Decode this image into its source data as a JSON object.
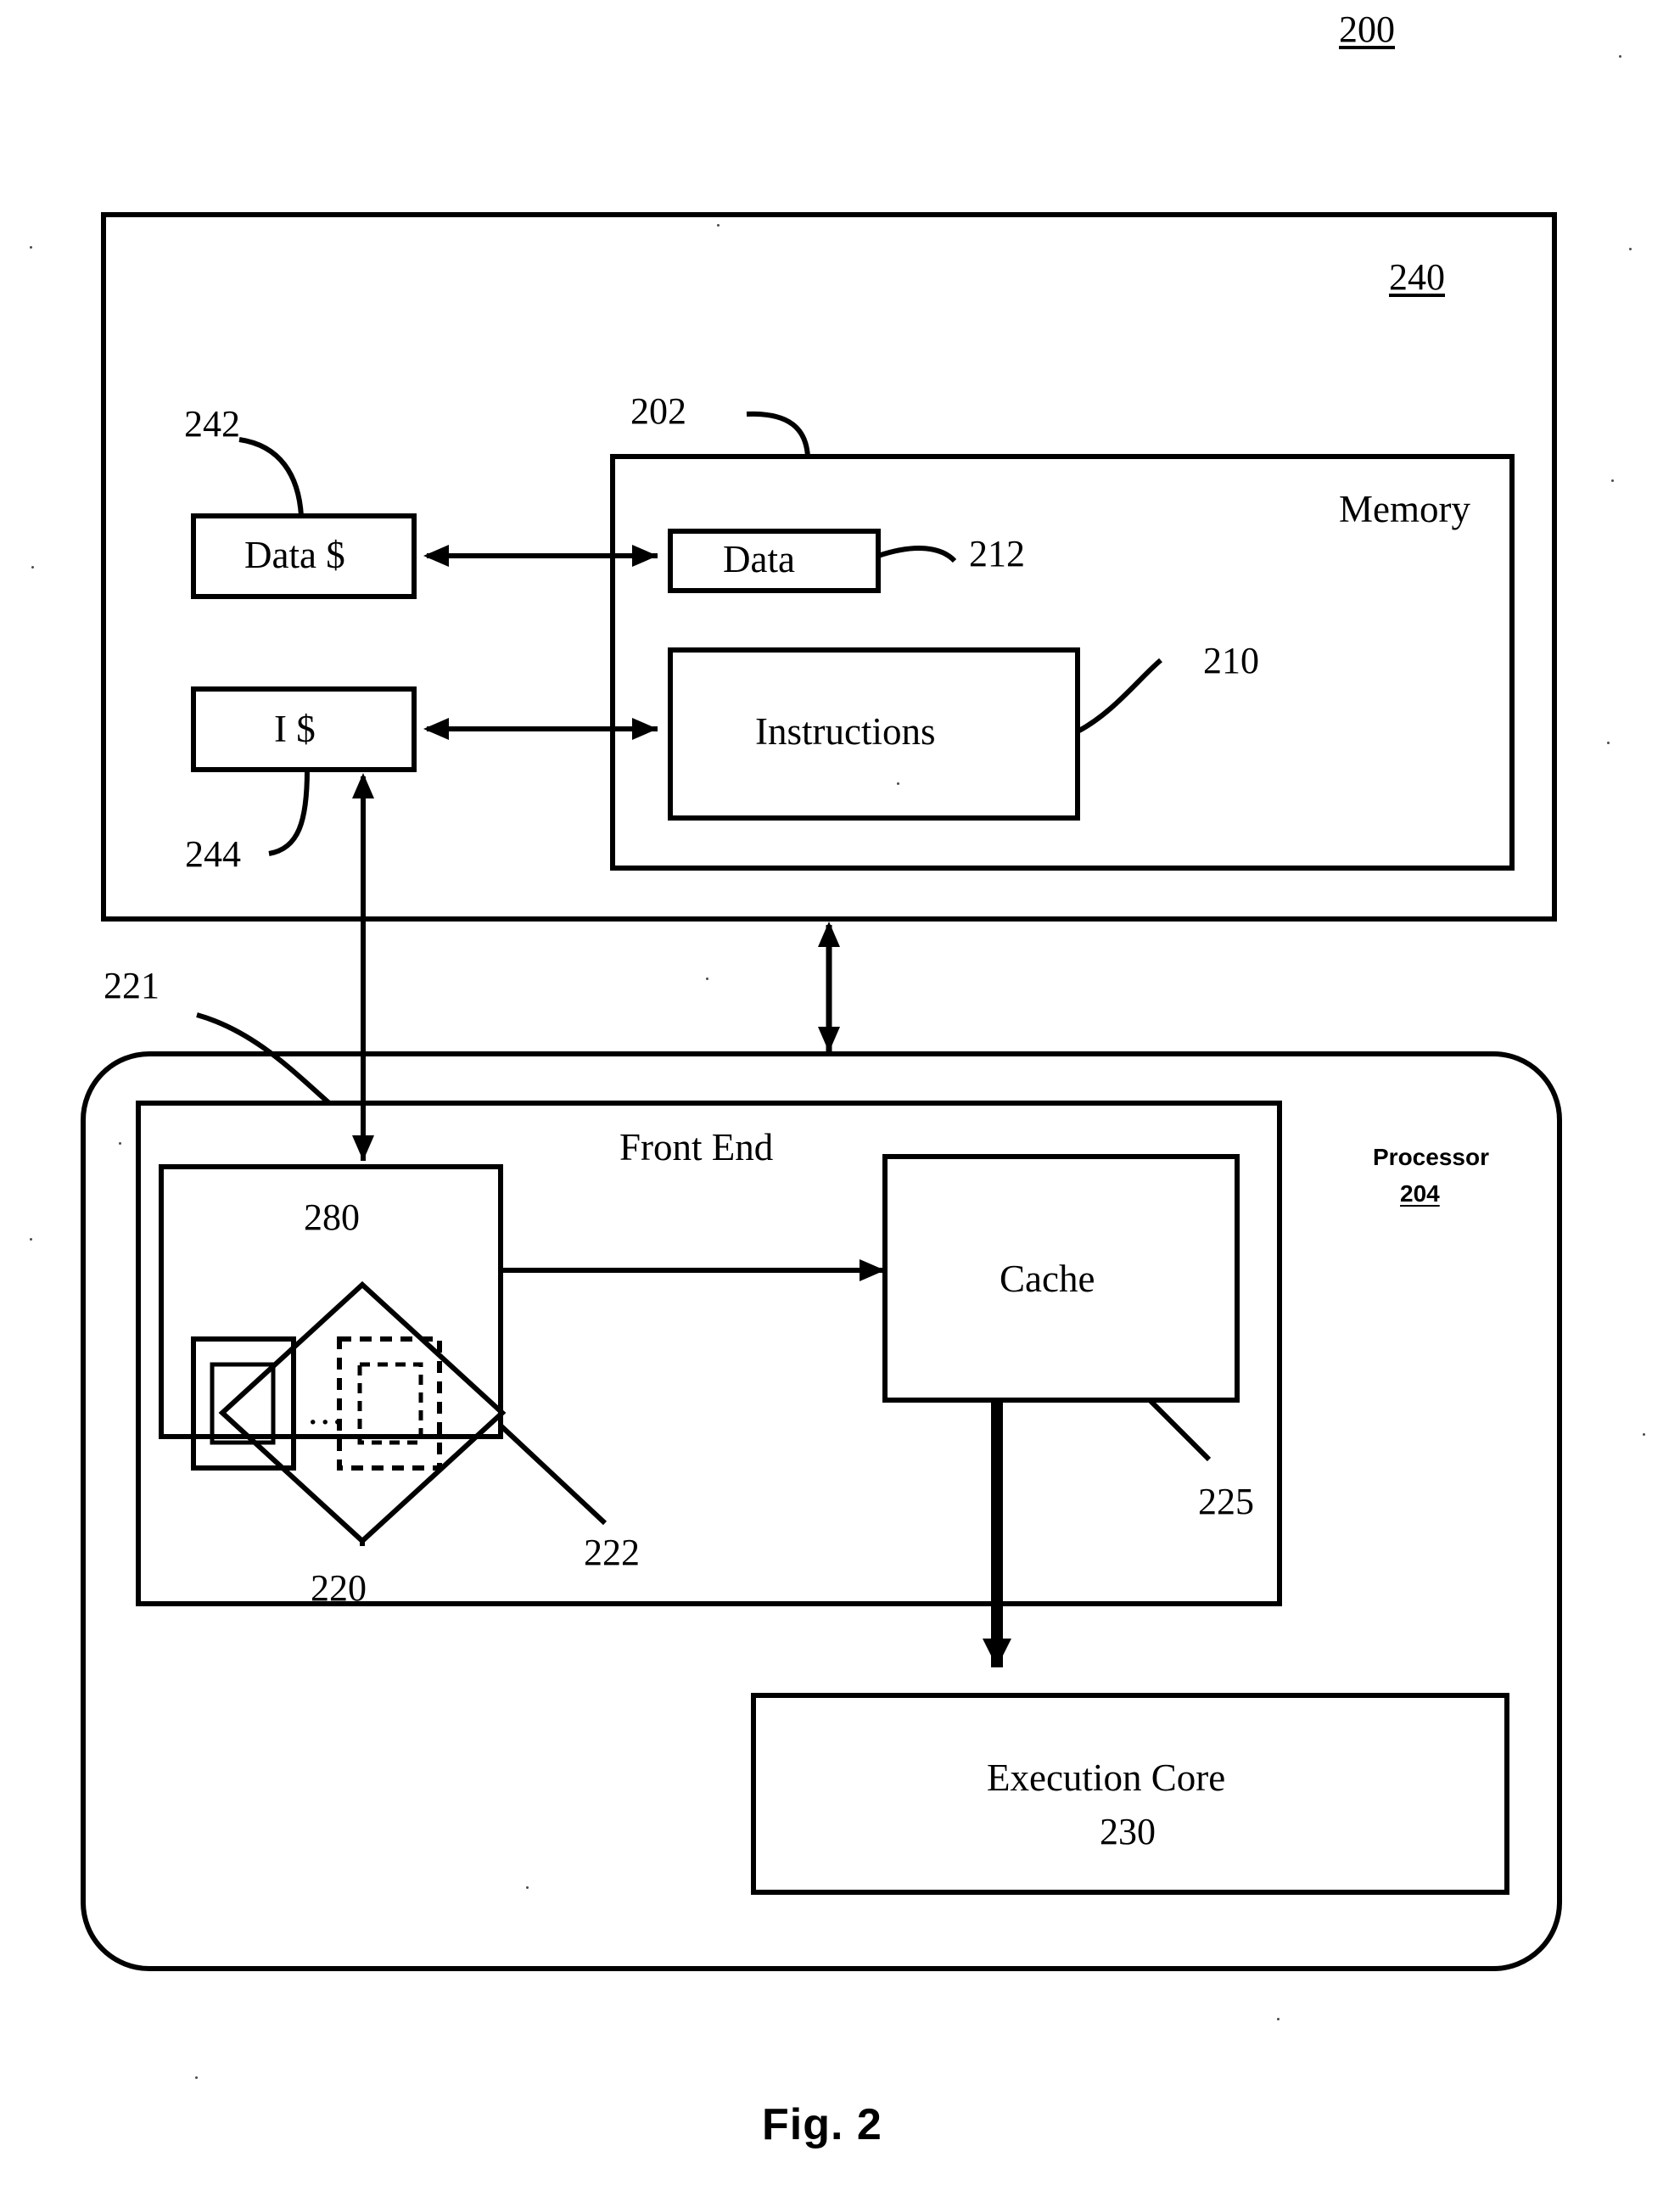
{
  "figure": {
    "caption": "Fig. 2",
    "top_ref": "200"
  },
  "memory_system": {
    "ref": "240",
    "caches": [
      {
        "label": "Data $",
        "ref": "242"
      },
      {
        "label": "I $",
        "ref": "244"
      }
    ],
    "memory_box": {
      "title": "Memory",
      "ref": "202",
      "regions": [
        {
          "label": "Data",
          "ref": "212"
        },
        {
          "label": "Instructions",
          "ref": "210"
        }
      ]
    }
  },
  "processor": {
    "title": "Processor",
    "ref": "204",
    "front_end": {
      "title": "Front End",
      "ref": "221",
      "trace_unit": {
        "ref": "222",
        "diamond_ref": "280",
        "group_ref": "220",
        "ellipsis": "...",
        "entries": [
          {
            "style": "solid"
          },
          {
            "style": "dashed"
          }
        ]
      },
      "cache": {
        "label": "Cache",
        "ref": "225"
      }
    },
    "execution_core": {
      "label": "Execution Core",
      "ref": "230"
    }
  },
  "colors": {
    "ink": "#000000",
    "paper": "#ffffff"
  },
  "chart_data": {
    "type": "diagram",
    "title": "Fig. 2",
    "nodes": [
      {
        "id": "240",
        "label": "",
        "ref": "240",
        "kind": "outer-container"
      },
      {
        "id": "242",
        "label": "Data $",
        "ref": "242",
        "kind": "box"
      },
      {
        "id": "244",
        "label": "I $",
        "ref": "244",
        "kind": "box"
      },
      {
        "id": "202",
        "label": "Memory",
        "ref": "202",
        "kind": "container"
      },
      {
        "id": "212",
        "label": "Data",
        "ref": "212",
        "kind": "box"
      },
      {
        "id": "210",
        "label": "Instructions",
        "ref": "210",
        "kind": "box"
      },
      {
        "id": "204",
        "label": "Processor",
        "ref": "204",
        "kind": "rounded-container"
      },
      {
        "id": "221",
        "label": "Front End",
        "ref": "221",
        "kind": "container"
      },
      {
        "id": "222",
        "label": "",
        "ref": "222",
        "kind": "box"
      },
      {
        "id": "280",
        "label": "",
        "ref": "280",
        "kind": "diamond"
      },
      {
        "id": "220",
        "label": "",
        "ref": "220",
        "kind": "group"
      },
      {
        "id": "225",
        "label": "Cache",
        "ref": "225",
        "kind": "box"
      },
      {
        "id": "230",
        "label": "Execution Core",
        "ref": "230",
        "kind": "box"
      }
    ],
    "edges": [
      {
        "from": "242",
        "to": "212",
        "type": "bidirectional"
      },
      {
        "from": "244",
        "to": "210",
        "type": "bidirectional"
      },
      {
        "from": "244",
        "to": "222",
        "type": "bidirectional-vertical"
      },
      {
        "from": "240",
        "to": "204",
        "type": "bidirectional-vertical"
      },
      {
        "from": "222",
        "to": "225",
        "type": "directed"
      },
      {
        "from": "225",
        "to": "230",
        "type": "directed-thick"
      }
    ]
  }
}
